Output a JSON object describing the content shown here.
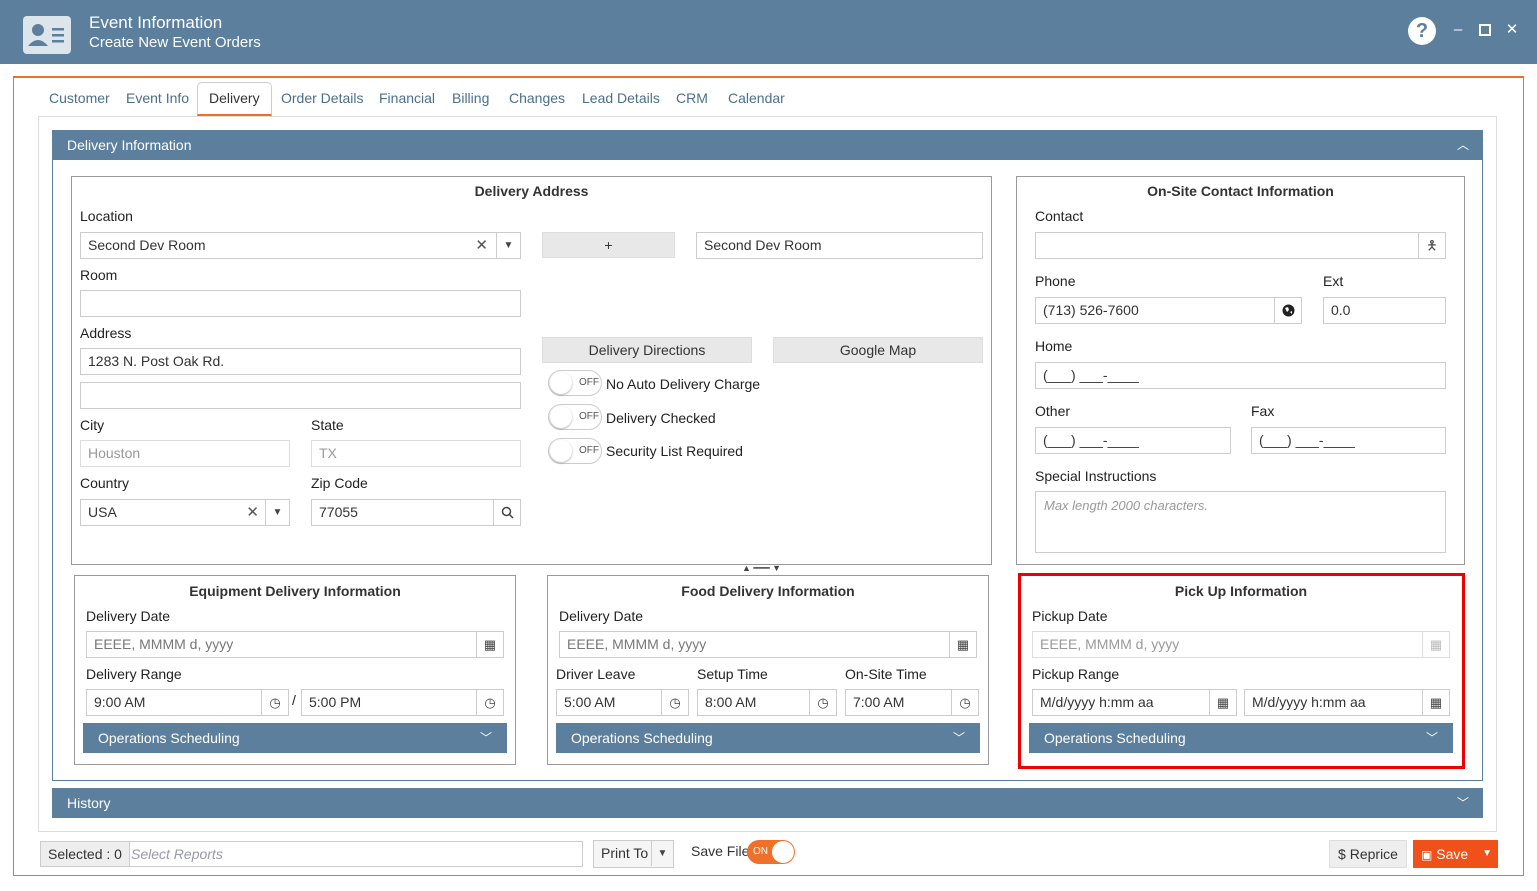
{
  "window": {
    "title": "Event Information",
    "subtitle": "Create New Event Orders",
    "help": "?",
    "min": "–",
    "max": "▫",
    "close": "✕"
  },
  "tabs": [
    "Customer",
    "Event Info",
    "Delivery",
    "Order Details",
    "Financial",
    "Billing",
    "Changes",
    "Lead Details",
    "CRM",
    "Calendar"
  ],
  "active_tab": "Delivery",
  "delivery_panel": {
    "title": "Delivery Information"
  },
  "delivery_address": {
    "title": "Delivery Address",
    "location_label": "Location",
    "location_value": "Second Dev Room",
    "add_button": "+",
    "location_name": "Second Dev Room",
    "room_label": "Room",
    "room_value": "",
    "address_label": "Address",
    "address1": "1283 N. Post Oak Rd.",
    "address2": "",
    "directions_button": "Delivery Directions",
    "map_button": "Google Map",
    "toggle_off": "OFF",
    "no_auto_charge": "No Auto Delivery Charge",
    "delivery_checked": "Delivery Checked",
    "security_list": "Security List Required",
    "city_label": "City",
    "city_value": "Houston",
    "state_label": "State",
    "state_value": "TX",
    "country_label": "Country",
    "country_value": "USA",
    "zip_label": "Zip Code",
    "zip_value": "77055"
  },
  "onsite": {
    "title": "On-Site Contact Information",
    "contact_label": "Contact",
    "contact_value": "",
    "phone_label": "Phone",
    "phone_value": "(713) 526-7600",
    "ext_label": "Ext",
    "ext_value": "0.0",
    "home_label": "Home",
    "home_value": "(___) ___-____",
    "other_label": "Other",
    "other_value": "(___) ___-____",
    "fax_label": "Fax",
    "fax_value": "(___) ___-____",
    "instructions_label": "Special Instructions",
    "instructions_placeholder": "Max length 2000 characters."
  },
  "equipment": {
    "title": "Equipment Delivery Information",
    "date_label": "Delivery Date",
    "date_value": "EEEE, MMMM d, yyyy",
    "range_label": "Delivery Range",
    "start": "9:00 AM",
    "sep": "/",
    "end": "5:00 PM",
    "ops": "Operations Scheduling"
  },
  "food": {
    "title": "Food Delivery Information",
    "date_label": "Delivery Date",
    "date_value": "EEEE, MMMM d, yyyy",
    "driver_label": "Driver Leave",
    "driver_value": "5:00 AM",
    "setup_label": "Setup Time",
    "setup_value": "8:00 AM",
    "onsite_label": "On-Site Time",
    "onsite_value": "7:00 AM",
    "ops": "Operations Scheduling"
  },
  "pickup": {
    "title": "Pick Up Information",
    "date_label": "Pickup Date",
    "date_value": "EEEE, MMMM d, yyyy",
    "range_label": "Pickup Range",
    "start": "M/d/yyyy h:mm aa",
    "end": "M/d/yyyy h:mm aa",
    "ops": "Operations Scheduling"
  },
  "history": {
    "title": "History"
  },
  "footer": {
    "selected": "Selected : 0",
    "select_reports": "Select Reports",
    "print_to": "Print To",
    "save_file": "Save File",
    "save_file_toggle": "ON",
    "reprice": "Reprice",
    "reprice_icon": "$",
    "save": "Save"
  },
  "colors": {
    "header": "#5b7f9c",
    "accent": "#f0702a",
    "highlight": "#e00000"
  }
}
